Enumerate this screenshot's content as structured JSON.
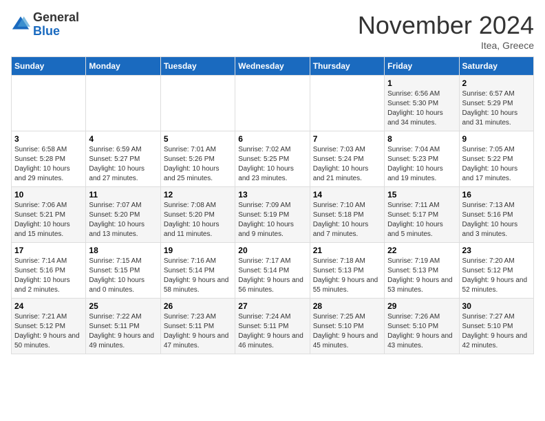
{
  "logo": {
    "general": "General",
    "blue": "Blue"
  },
  "header": {
    "month": "November 2024",
    "location": "Itea, Greece"
  },
  "weekdays": [
    "Sunday",
    "Monday",
    "Tuesday",
    "Wednesday",
    "Thursday",
    "Friday",
    "Saturday"
  ],
  "weeks": [
    [
      {
        "day": "",
        "info": ""
      },
      {
        "day": "",
        "info": ""
      },
      {
        "day": "",
        "info": ""
      },
      {
        "day": "",
        "info": ""
      },
      {
        "day": "",
        "info": ""
      },
      {
        "day": "1",
        "info": "Sunrise: 6:56 AM\nSunset: 5:30 PM\nDaylight: 10 hours and 34 minutes."
      },
      {
        "day": "2",
        "info": "Sunrise: 6:57 AM\nSunset: 5:29 PM\nDaylight: 10 hours and 31 minutes."
      }
    ],
    [
      {
        "day": "3",
        "info": "Sunrise: 6:58 AM\nSunset: 5:28 PM\nDaylight: 10 hours and 29 minutes."
      },
      {
        "day": "4",
        "info": "Sunrise: 6:59 AM\nSunset: 5:27 PM\nDaylight: 10 hours and 27 minutes."
      },
      {
        "day": "5",
        "info": "Sunrise: 7:01 AM\nSunset: 5:26 PM\nDaylight: 10 hours and 25 minutes."
      },
      {
        "day": "6",
        "info": "Sunrise: 7:02 AM\nSunset: 5:25 PM\nDaylight: 10 hours and 23 minutes."
      },
      {
        "day": "7",
        "info": "Sunrise: 7:03 AM\nSunset: 5:24 PM\nDaylight: 10 hours and 21 minutes."
      },
      {
        "day": "8",
        "info": "Sunrise: 7:04 AM\nSunset: 5:23 PM\nDaylight: 10 hours and 19 minutes."
      },
      {
        "day": "9",
        "info": "Sunrise: 7:05 AM\nSunset: 5:22 PM\nDaylight: 10 hours and 17 minutes."
      }
    ],
    [
      {
        "day": "10",
        "info": "Sunrise: 7:06 AM\nSunset: 5:21 PM\nDaylight: 10 hours and 15 minutes."
      },
      {
        "day": "11",
        "info": "Sunrise: 7:07 AM\nSunset: 5:20 PM\nDaylight: 10 hours and 13 minutes."
      },
      {
        "day": "12",
        "info": "Sunrise: 7:08 AM\nSunset: 5:20 PM\nDaylight: 10 hours and 11 minutes."
      },
      {
        "day": "13",
        "info": "Sunrise: 7:09 AM\nSunset: 5:19 PM\nDaylight: 10 hours and 9 minutes."
      },
      {
        "day": "14",
        "info": "Sunrise: 7:10 AM\nSunset: 5:18 PM\nDaylight: 10 hours and 7 minutes."
      },
      {
        "day": "15",
        "info": "Sunrise: 7:11 AM\nSunset: 5:17 PM\nDaylight: 10 hours and 5 minutes."
      },
      {
        "day": "16",
        "info": "Sunrise: 7:13 AM\nSunset: 5:16 PM\nDaylight: 10 hours and 3 minutes."
      }
    ],
    [
      {
        "day": "17",
        "info": "Sunrise: 7:14 AM\nSunset: 5:16 PM\nDaylight: 10 hours and 2 minutes."
      },
      {
        "day": "18",
        "info": "Sunrise: 7:15 AM\nSunset: 5:15 PM\nDaylight: 10 hours and 0 minutes."
      },
      {
        "day": "19",
        "info": "Sunrise: 7:16 AM\nSunset: 5:14 PM\nDaylight: 9 hours and 58 minutes."
      },
      {
        "day": "20",
        "info": "Sunrise: 7:17 AM\nSunset: 5:14 PM\nDaylight: 9 hours and 56 minutes."
      },
      {
        "day": "21",
        "info": "Sunrise: 7:18 AM\nSunset: 5:13 PM\nDaylight: 9 hours and 55 minutes."
      },
      {
        "day": "22",
        "info": "Sunrise: 7:19 AM\nSunset: 5:13 PM\nDaylight: 9 hours and 53 minutes."
      },
      {
        "day": "23",
        "info": "Sunrise: 7:20 AM\nSunset: 5:12 PM\nDaylight: 9 hours and 52 minutes."
      }
    ],
    [
      {
        "day": "24",
        "info": "Sunrise: 7:21 AM\nSunset: 5:12 PM\nDaylight: 9 hours and 50 minutes."
      },
      {
        "day": "25",
        "info": "Sunrise: 7:22 AM\nSunset: 5:11 PM\nDaylight: 9 hours and 49 minutes."
      },
      {
        "day": "26",
        "info": "Sunrise: 7:23 AM\nSunset: 5:11 PM\nDaylight: 9 hours and 47 minutes."
      },
      {
        "day": "27",
        "info": "Sunrise: 7:24 AM\nSunset: 5:11 PM\nDaylight: 9 hours and 46 minutes."
      },
      {
        "day": "28",
        "info": "Sunrise: 7:25 AM\nSunset: 5:10 PM\nDaylight: 9 hours and 45 minutes."
      },
      {
        "day": "29",
        "info": "Sunrise: 7:26 AM\nSunset: 5:10 PM\nDaylight: 9 hours and 43 minutes."
      },
      {
        "day": "30",
        "info": "Sunrise: 7:27 AM\nSunset: 5:10 PM\nDaylight: 9 hours and 42 minutes."
      }
    ]
  ]
}
